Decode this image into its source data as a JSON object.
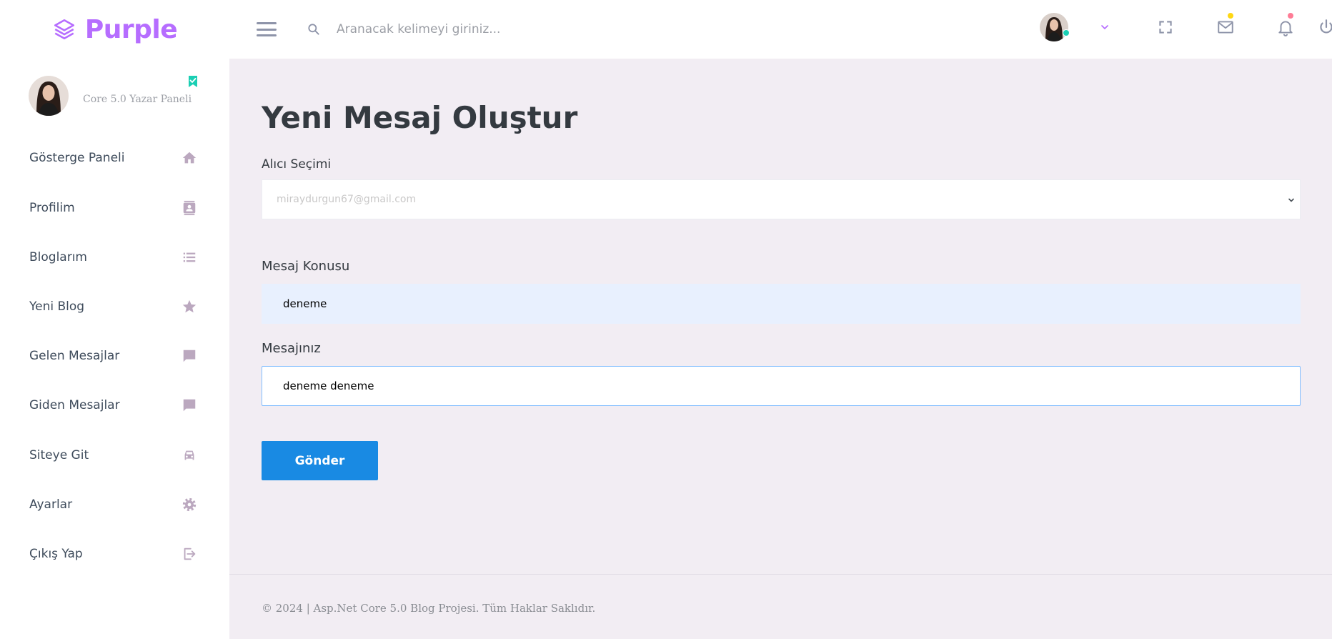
{
  "brand": {
    "name": "Purple",
    "color": "#b66dff"
  },
  "search": {
    "placeholder": "Aranacak kelimeyi giriniz..."
  },
  "navbar": {
    "icons": [
      "menu-icon",
      "search-icon",
      "chevron-down-icon",
      "fullscreen-icon",
      "mail-icon",
      "bell-icon",
      "power-icon"
    ],
    "indicator_colors": {
      "online": "#1bcfb4",
      "mail": "#fed713",
      "bell": "#fe7c96"
    }
  },
  "sidebar": {
    "profile": {
      "name": "Core 5.0 Yazar Paneli"
    },
    "items": [
      {
        "label": "Gösterge Paneli",
        "icon": "home-icon"
      },
      {
        "label": "Profilim",
        "icon": "contact-card-icon"
      },
      {
        "label": "Bloglarım",
        "icon": "list-icon"
      },
      {
        "label": "Yeni Blog",
        "icon": "star-icon"
      },
      {
        "label": "Gelen Mesajlar",
        "icon": "message-icon"
      },
      {
        "label": "Giden Mesajlar",
        "icon": "message-icon"
      },
      {
        "label": "Siteye Git",
        "icon": "car-icon"
      },
      {
        "label": "Ayarlar",
        "icon": "gear-icon"
      },
      {
        "label": "Çıkış Yap",
        "icon": "logout-icon"
      }
    ]
  },
  "main": {
    "title": "Yeni Mesaj Oluştur",
    "recipient": {
      "label": "Alıcı Seçimi",
      "value": "miraydurgun67@gmail.com"
    },
    "subject": {
      "label": "Mesaj Konusu",
      "value": "deneme"
    },
    "message": {
      "label": "Mesajınız",
      "value": "deneme deneme"
    },
    "submit_label": "Gönder",
    "submit_color": "#198ae3"
  },
  "footer": {
    "text": "© 2024 | Asp.Net Core 5.0 Blog Projesi. Tüm Haklar Saklıdır."
  }
}
